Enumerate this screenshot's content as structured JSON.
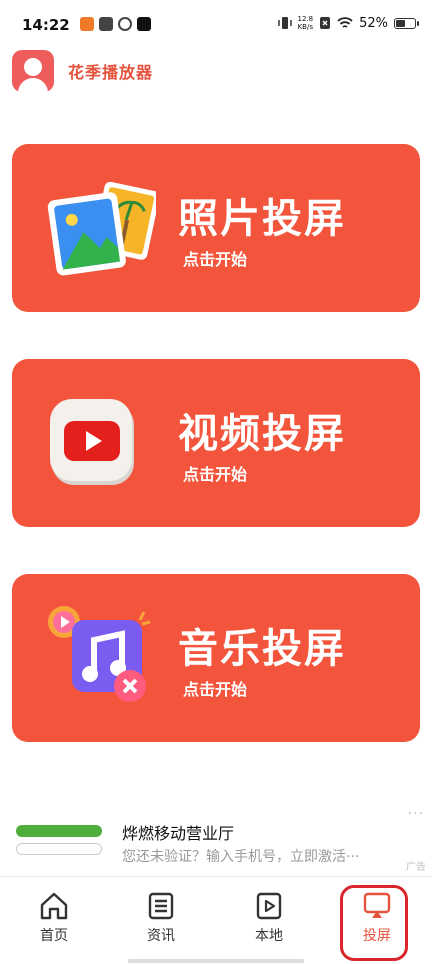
{
  "status": {
    "time": "14:22",
    "speed_value": "12.8",
    "speed_unit": "KB/s",
    "battery": "52%"
  },
  "header": {
    "title": "花季播放器",
    "avatar_icon": "user-avatar-icon"
  },
  "cards": [
    {
      "title": "照片投屏",
      "subtitle": "点击开始",
      "icon": "photo-gallery-icon"
    },
    {
      "title": "视频投屏",
      "subtitle": "点击开始",
      "icon": "video-play-icon"
    },
    {
      "title": "音乐投屏",
      "subtitle": "点击开始",
      "icon": "music-note-icon"
    }
  ],
  "ad": {
    "title": "烨燃移动营业厅",
    "description": "您还未验证？输入手机号，立即激活···",
    "tag": "广告",
    "more": "···"
  },
  "tabbar": {
    "items": [
      {
        "label": "首页",
        "icon": "home-icon"
      },
      {
        "label": "资讯",
        "icon": "news-icon"
      },
      {
        "label": "本地",
        "icon": "local-play-icon"
      },
      {
        "label": "投屏",
        "icon": "cast-icon"
      }
    ],
    "active_index": 3
  },
  "colors": {
    "card_bg": "#f2553c",
    "accent": "#e5533d",
    "highlight": "#d9262c"
  }
}
